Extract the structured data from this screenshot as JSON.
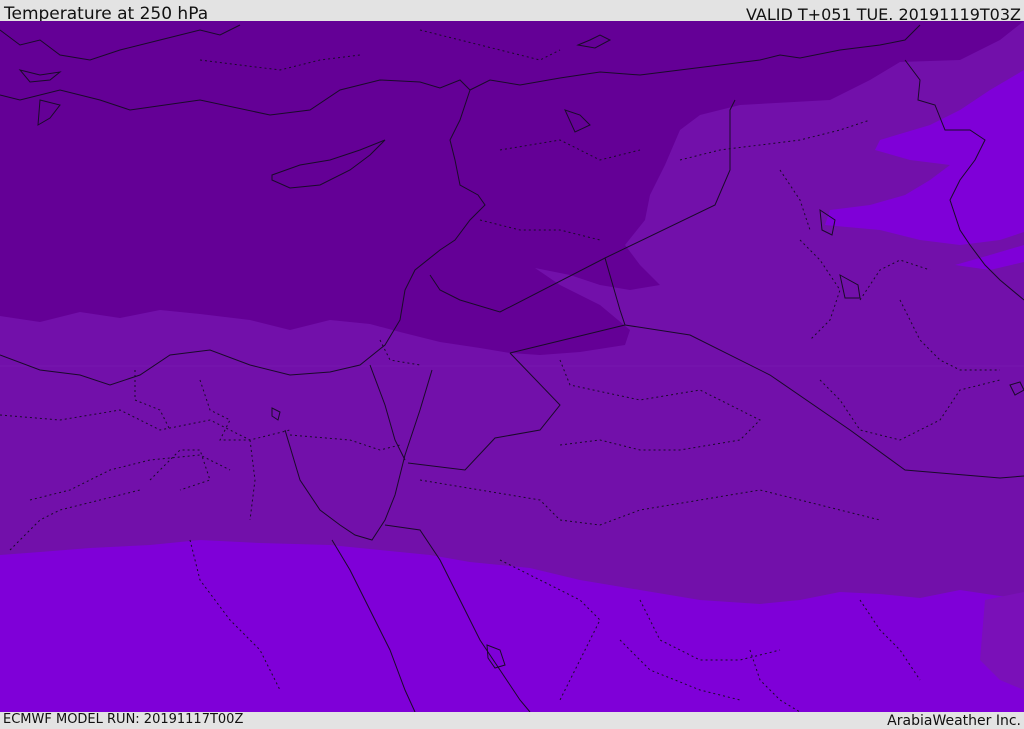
{
  "header": {
    "title": "Temperature at 250 hPa",
    "valid_time": "VALID T+051 TUE. 20191119T03Z"
  },
  "footer": {
    "model_run": "ECMWF MODEL RUN: 20191117T00Z",
    "credit": "ArabiaWeather Inc."
  },
  "map": {
    "field": "Temperature at 250 hPa",
    "colors": {
      "coldest": "#640096",
      "cold": "#7210aa",
      "warmer": "#7f00d8",
      "coastline": "#1a0a2a"
    }
  }
}
